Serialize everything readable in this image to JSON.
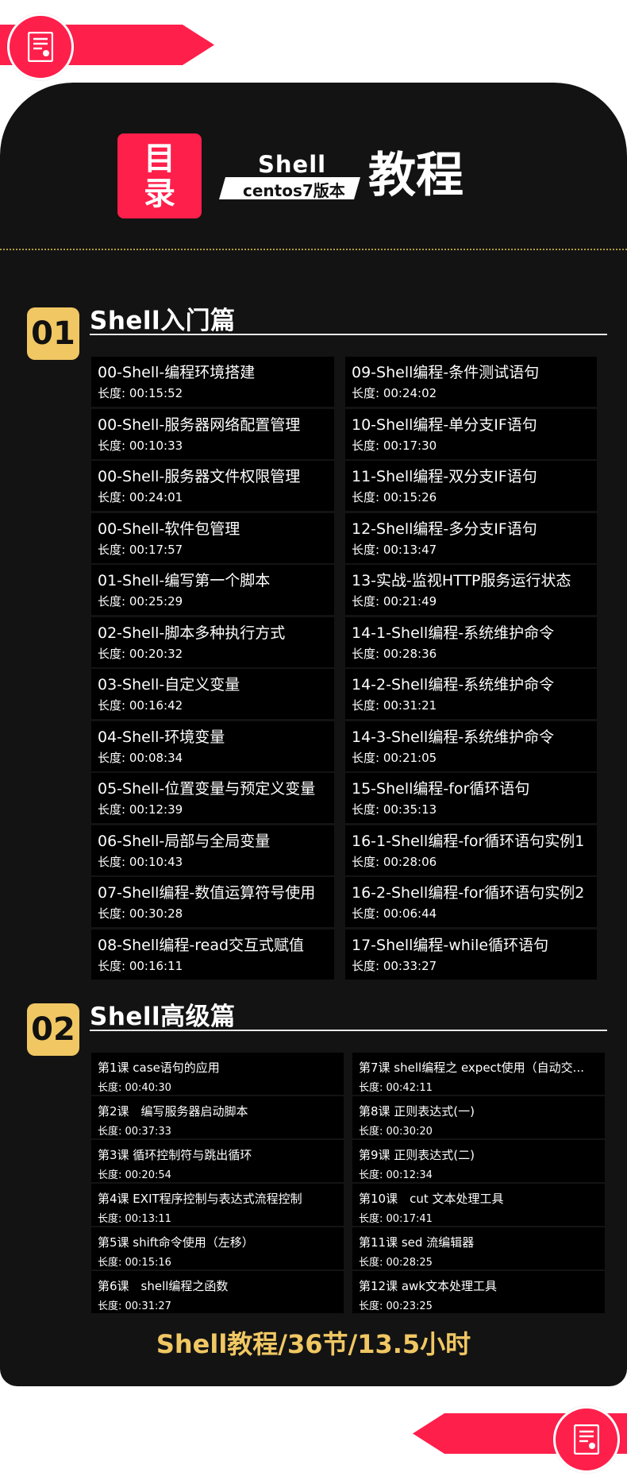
{
  "header": {
    "mulu_1": "目",
    "mulu_2": "录",
    "shell": "Shell",
    "version": "centos7版本",
    "tutorial": "教程"
  },
  "sections": [
    {
      "number": "01",
      "title": "Shell入门篇",
      "left": [
        {
          "title": "00-Shell-编程环境搭建",
          "duration": "长度: 00:15:52"
        },
        {
          "title": "00-Shell-服务器网络配置管理",
          "duration": "长度: 00:10:33"
        },
        {
          "title": "00-Shell-服务器文件权限管理",
          "duration": "长度: 00:24:01"
        },
        {
          "title": "00-Shell-软件包管理",
          "duration": "长度: 00:17:57"
        },
        {
          "title": "01-Shell-编写第一个脚本",
          "duration": "长度: 00:25:29"
        },
        {
          "title": "02-Shell-脚本多种执行方式",
          "duration": "长度: 00:20:32"
        },
        {
          "title": "03-Shell-自定义变量",
          "duration": "长度: 00:16:42"
        },
        {
          "title": "04-Shell-环境变量",
          "duration": "长度: 00:08:34"
        },
        {
          "title": "05-Shell-位置变量与预定义变量",
          "duration": "长度: 00:12:39"
        },
        {
          "title": "06-Shell-局部与全局变量",
          "duration": "长度: 00:10:43"
        },
        {
          "title": "07-Shell编程-数值运算符号使用",
          "duration": "长度: 00:30:28"
        },
        {
          "title": "08-Shell编程-read交互式赋值",
          "duration": "长度: 00:16:11"
        }
      ],
      "right": [
        {
          "title": "09-Shell编程-条件测试语句",
          "duration": "长度: 00:24:02"
        },
        {
          "title": "10-Shell编程-单分支IF语句",
          "duration": "长度: 00:17:30"
        },
        {
          "title": "11-Shell编程-双分支IF语句",
          "duration": "长度: 00:15:26"
        },
        {
          "title": "12-Shell编程-多分支IF语句",
          "duration": "长度: 00:13:47"
        },
        {
          "title": "13-实战-监视HTTP服务运行状态",
          "duration": "长度: 00:21:49"
        },
        {
          "title": "14-1-Shell编程-系统维护命令",
          "duration": "长度: 00:28:36"
        },
        {
          "title": "14-2-Shell编程-系统维护命令",
          "duration": "长度: 00:31:21"
        },
        {
          "title": "14-3-Shell编程-系统维护命令",
          "duration": "长度: 00:21:05"
        },
        {
          "title": "15-Shell编程-for循环语句",
          "duration": "长度: 00:35:13"
        },
        {
          "title": "16-1-Shell编程-for循环语句实例1",
          "duration": "长度: 00:28:06"
        },
        {
          "title": "16-2-Shell编程-for循环语句实例2",
          "duration": "长度: 00:06:44"
        },
        {
          "title": "17-Shell编程-while循环语句",
          "duration": "长度: 00:33:27"
        }
      ]
    },
    {
      "number": "02",
      "title": "Shell高级篇",
      "left": [
        {
          "title": "第1课 case语句的应用",
          "duration": "长度: 00:40:30"
        },
        {
          "title": "第2课　编写服务器启动脚本",
          "duration": "长度: 00:37:33"
        },
        {
          "title": "第3课 循环控制符与跳出循环",
          "duration": "长度: 00:20:54"
        },
        {
          "title": "第4课 EXIT程序控制与表达式流程控制",
          "duration": "长度: 00:13:11"
        },
        {
          "title": "第5课 shift命令使用（左移）",
          "duration": "长度: 00:15:16"
        },
        {
          "title": "第6课　shell编程之函数",
          "duration": "长度: 00:31:27"
        }
      ],
      "right": [
        {
          "title": "第7课 shell编程之 expect使用（自动交...",
          "duration": "长度: 00:42:11"
        },
        {
          "title": "第8课 正则表达式(一)",
          "duration": "长度: 00:30:20"
        },
        {
          "title": "第9课 正则表达式(二)",
          "duration": "长度: 00:12:34"
        },
        {
          "title": "第10课　cut 文本处理工具",
          "duration": "长度: 00:17:41"
        },
        {
          "title": "第11课 sed 流编辑器",
          "duration": "长度: 00:28:25"
        },
        {
          "title": "第12课 awk文本处理工具",
          "duration": "长度: 00:23:25"
        }
      ]
    }
  ],
  "footer": "Shell教程/36节/13.5小时",
  "colors": {
    "accent_red": "#ff1f4b",
    "gold": "#f0c763",
    "card": "#131313"
  },
  "icons": [
    "certificate-icon"
  ]
}
